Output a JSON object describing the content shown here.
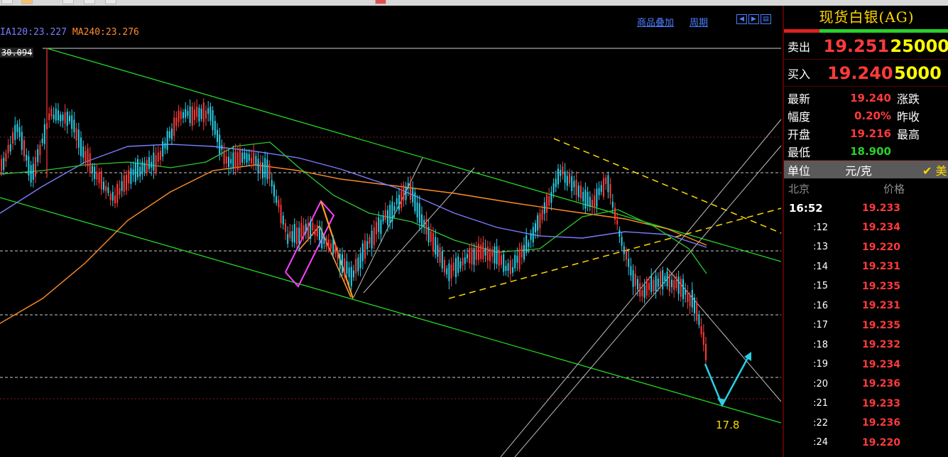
{
  "chart": {
    "ma_legend": {
      "ma120": "IA120:23.227",
      "ma240": "MA240:23.276"
    },
    "high_label": "30.094",
    "toolbar_links": [
      "商品叠加",
      "周期"
    ],
    "target_label": "17.8",
    "colors": {
      "up_candle": "#ff3a3a",
      "down_candle": "#28d0e8",
      "channel": "#22d622",
      "ma120": "#7b7bff",
      "ma240": "#ff8c2a",
      "trend_dashed": "#ffd800",
      "arrow": "#28d0e8"
    }
  },
  "panel": {
    "title": "现货白银(AG)",
    "sell": {
      "label": "卖出",
      "price": "19.251",
      "qty": "25000"
    },
    "buy": {
      "label": "买入",
      "price": "19.240",
      "qty": "5000"
    },
    "stats": [
      {
        "k": "最新",
        "v": "19.240",
        "k2": "涨跌",
        "color": "red"
      },
      {
        "k": "幅度",
        "v": "0.20%",
        "k2": "昨收",
        "color": "red"
      },
      {
        "k": "开盘",
        "v": "19.216",
        "k2": "最高",
        "color": "red"
      },
      {
        "k": "最低",
        "v": "18.900",
        "k2": "",
        "color": "green"
      }
    ],
    "unit": {
      "label": "单位",
      "value": "元/克",
      "check": "✔ 美"
    },
    "ticks_header": {
      "time": "北京",
      "price": "价格"
    },
    "ticks": [
      {
        "time": "16:52",
        "price": "19.233"
      },
      {
        "time": ":12",
        "price": "19.234"
      },
      {
        "time": ":13",
        "price": "19.220"
      },
      {
        "time": ":14",
        "price": "19.231"
      },
      {
        "time": ":15",
        "price": "19.235"
      },
      {
        "time": ":16",
        "price": "19.231"
      },
      {
        "time": ":17",
        "price": "19.235"
      },
      {
        "time": ":18",
        "price": "19.232"
      },
      {
        "time": ":19",
        "price": "19.234"
      },
      {
        "time": ":20",
        "price": "19.236"
      },
      {
        "time": ":21",
        "price": "19.233"
      },
      {
        "time": ":22",
        "price": "19.236"
      },
      {
        "time": ":24",
        "price": "19.220"
      }
    ]
  }
}
